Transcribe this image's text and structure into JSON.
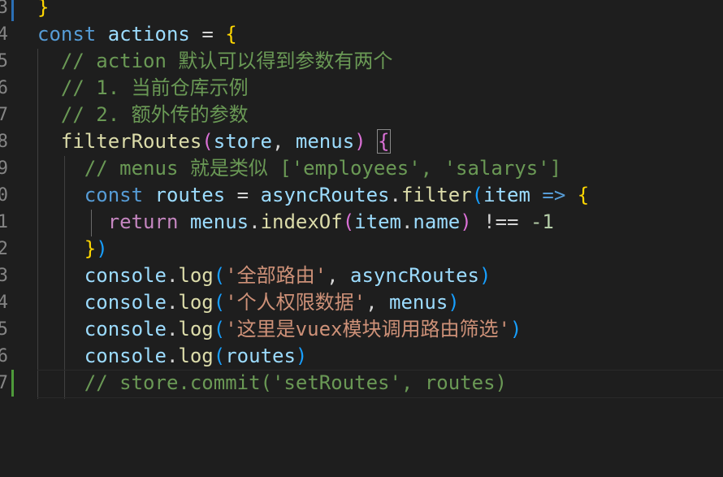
{
  "line_numbers": [
    "3",
    "4",
    "5",
    "6",
    "7",
    "8",
    "9",
    "0",
    "1",
    "2",
    "3",
    "4",
    "5",
    "6",
    "7"
  ],
  "lines": {
    "l3": {
      "brace": "}"
    },
    "l4": {
      "kw": "const",
      "name": "actions",
      "eq": "=",
      "brace": "{"
    },
    "l5": {
      "comment": "// action 默认可以得到参数有两个"
    },
    "l6": {
      "comment": "// 1. 当前仓库示例"
    },
    "l7": {
      "comment": "// 2. 额外传的参数"
    },
    "l8": {
      "fn": "filterRoutes",
      "open": "(",
      "p1": "store",
      "comma": ",",
      "p2": "menus",
      "close": ")",
      "brace": "{"
    },
    "l9": {
      "comment": "// menus 就是类似 ['employees', 'salarys']"
    },
    "l10": {
      "kw": "const",
      "name": "routes",
      "eq": "=",
      "obj": "asyncRoutes",
      "dot": ".",
      "method": "filter",
      "open": "(",
      "param": "item",
      "arrow": "=>",
      "brace": "{"
    },
    "l11": {
      "kw": "return",
      "obj": "menus",
      "dot": ".",
      "method": "indexOf",
      "open": "(",
      "arg": "item",
      "dot2": ".",
      "prop": "name",
      "close": ")",
      "op": "!==",
      "num": "-1"
    },
    "l12": {
      "brace": "}",
      "close": ")"
    },
    "l13": {
      "obj": "console",
      "dot": ".",
      "method": "log",
      "open": "(",
      "str": "'全部路由'",
      "comma": ",",
      "arg": "asyncRoutes",
      "close": ")"
    },
    "l14": {
      "obj": "console",
      "dot": ".",
      "method": "log",
      "open": "(",
      "str": "'个人权限数据'",
      "comma": ",",
      "arg": "menus",
      "close": ")"
    },
    "l15": {
      "obj": "console",
      "dot": ".",
      "method": "log",
      "open": "(",
      "str": "'这里是vuex模块调用路由筛选'",
      "close": ")"
    },
    "l16": {
      "obj": "console",
      "dot": ".",
      "method": "log",
      "open": "(",
      "arg": "routes",
      "close": ")"
    },
    "l17": {
      "comment": "// store.commit('setRoutes', routes)"
    }
  },
  "colors": {
    "background": "#1e1e1e",
    "keyword": "#569cd6",
    "variable": "#9cdcfe",
    "function": "#dcdcaa",
    "string": "#ce9178",
    "comment": "#6a9955",
    "bracket_level1": "#ffd700",
    "bracket_level2": "#da70d6",
    "bracket_level3": "#179fff",
    "modified_gutter": "#2b6fb5",
    "added_gutter": "#4e9a3a"
  }
}
